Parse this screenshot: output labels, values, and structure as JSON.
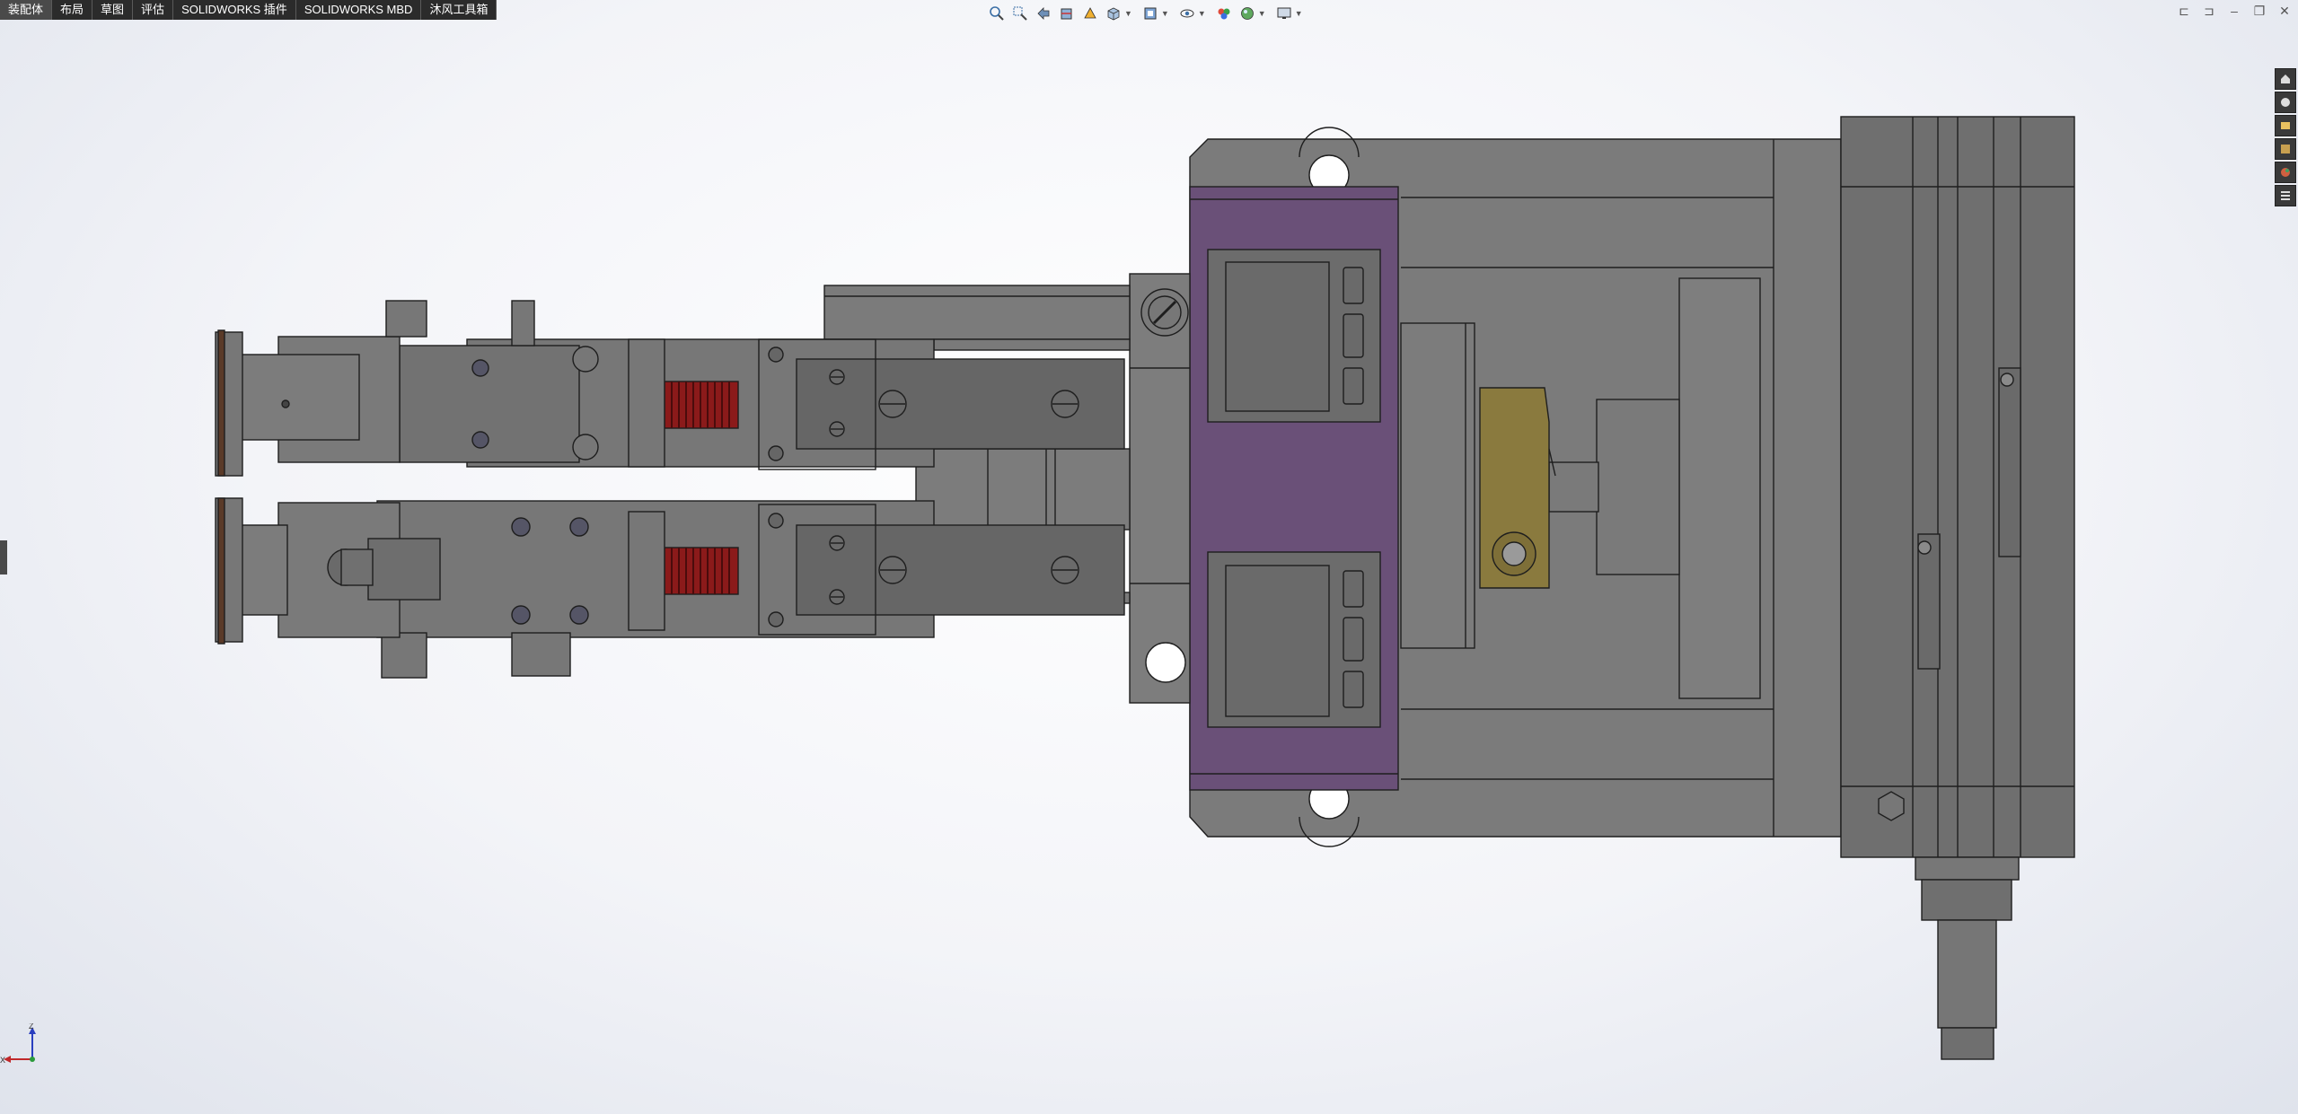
{
  "command_tabs": [
    {
      "label": "装配体",
      "active": true
    },
    {
      "label": "布局",
      "active": false
    },
    {
      "label": "草图",
      "active": false
    },
    {
      "label": "评估",
      "active": false
    },
    {
      "label": "SOLIDWORKS 插件",
      "active": false
    },
    {
      "label": "SOLIDWORKS MBD",
      "active": false
    },
    {
      "label": "沐风工具箱",
      "active": false
    }
  ],
  "heads_up_toolbar": [
    "zoom-to-fit-icon",
    "zoom-to-area-icon",
    "previous-view-icon",
    "section-view-icon",
    "dynamic-annotation-icon",
    "view-orientation-icon",
    "display-style-icon",
    "hide-show-items-icon",
    "edit-appearance-icon",
    "apply-scene-icon",
    "view-settings-icon"
  ],
  "window_controls": [
    "tile-left-icon",
    "tile-right-icon",
    "minimize-icon",
    "restore-icon",
    "close-icon"
  ],
  "task_pane": [
    "home-icon",
    "resources-icon",
    "design-library-icon",
    "file-explorer-icon",
    "appearances-icon",
    "custom-properties-icon"
  ],
  "triad": {
    "z_label": "Z",
    "x_label": "X"
  },
  "colors": {
    "part_gray": "#7a7a7a",
    "part_dark": "#5f5f5f",
    "purple_body": "#6a5078",
    "brass_part": "#8a7a3e",
    "spring_red": "#8b1a1a",
    "toolbar_bg": "#2b2b2b"
  }
}
